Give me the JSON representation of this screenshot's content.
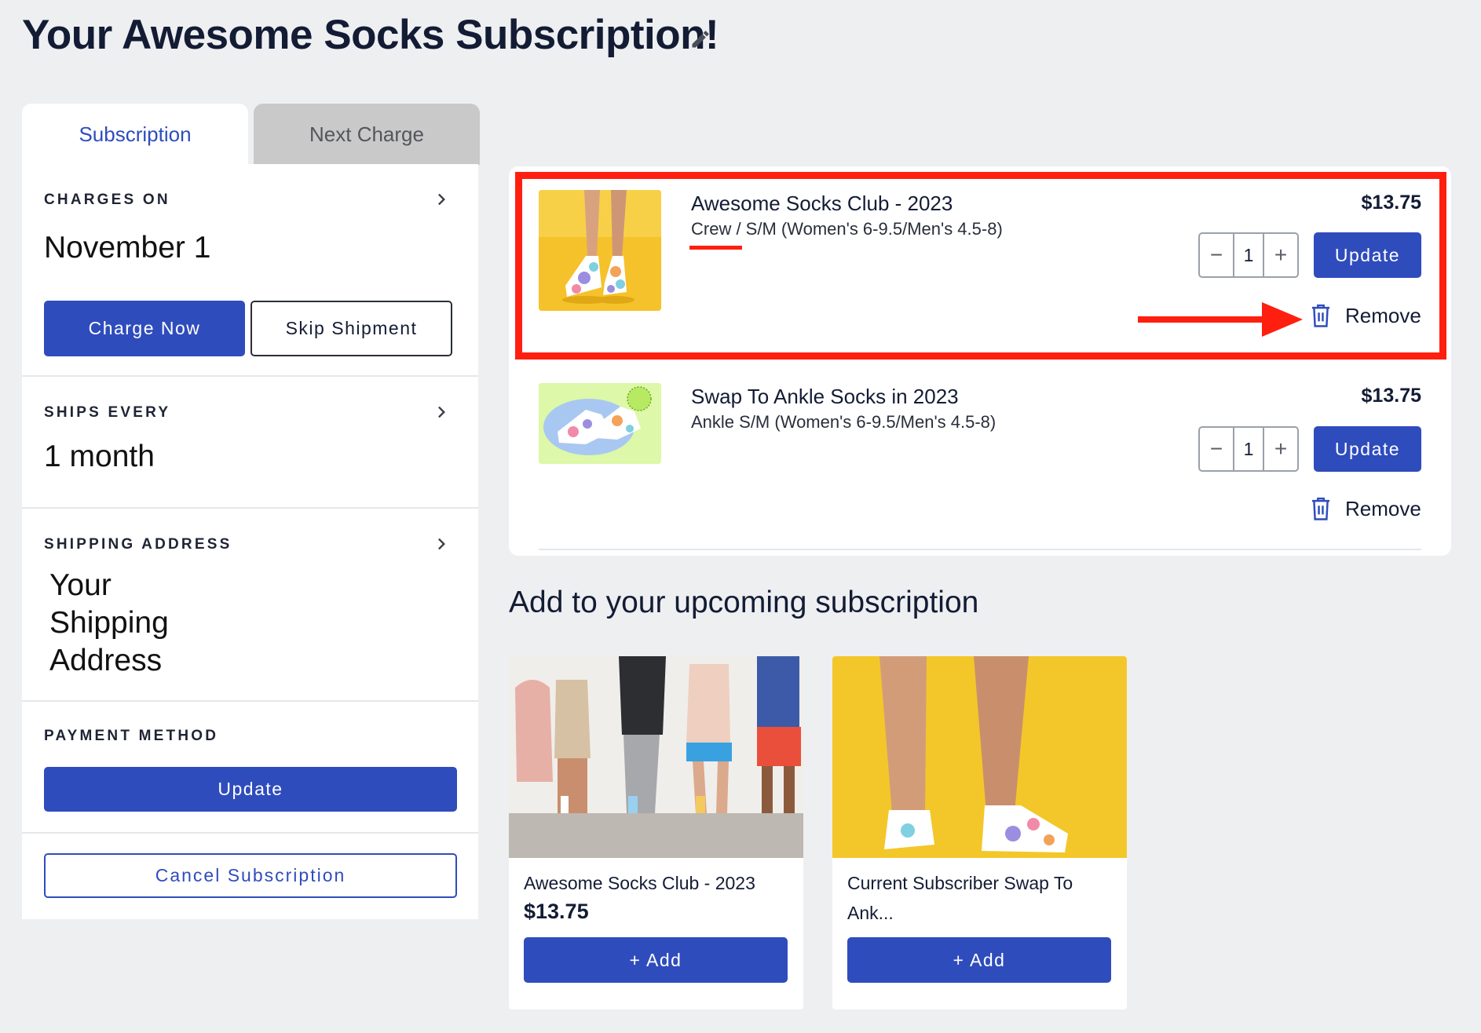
{
  "page": {
    "title": "Your Awesome Socks Subscription!",
    "edit_icon": "pencil-icon"
  },
  "tabs": [
    {
      "label": "Subscription",
      "active": true
    },
    {
      "label": "Next Charge",
      "active": false
    }
  ],
  "charges_on": {
    "label": "CHARGES ON",
    "value": "November 1",
    "charge_now_label": "Charge Now",
    "skip_label": "Skip Shipment"
  },
  "ships_every": {
    "label": "SHIPS EVERY",
    "value": "1 month"
  },
  "shipping_address": {
    "label": "SHIPPING ADDRESS",
    "lines": [
      "Your",
      "Shipping",
      "Address"
    ]
  },
  "payment": {
    "label": "PAYMENT METHOD",
    "update_label": "Update"
  },
  "cancel": {
    "label": "Cancel Subscription"
  },
  "cart": {
    "items": [
      {
        "title": "Awesome Socks Club - 2023",
        "variant": "Crew / S/M (Women's 6-9.5/Men's 4.5-8)",
        "price": "$13.75",
        "quantity": "1",
        "update_label": "Update",
        "remove_label": "Remove",
        "highlighted": true
      },
      {
        "title": "Swap To Ankle Socks in 2023",
        "variant": "Ankle S/M (Women's 6-9.5/Men's 4.5-8)",
        "price": "$13.75",
        "quantity": "1",
        "update_label": "Update",
        "remove_label": "Remove",
        "highlighted": false
      }
    ]
  },
  "upcoming": {
    "title": "Add to your upcoming subscription",
    "products": [
      {
        "name": "Awesome Socks Club - 2023",
        "price": "$13.75",
        "add_label": "+ Add"
      },
      {
        "name": "Current Subscriber Swap To Ank...",
        "price": "",
        "add_label": "+ Add"
      }
    ]
  },
  "colors": {
    "accent": "#2f4cbd",
    "highlight": "#ff1f10",
    "background": "#eeeff1"
  }
}
